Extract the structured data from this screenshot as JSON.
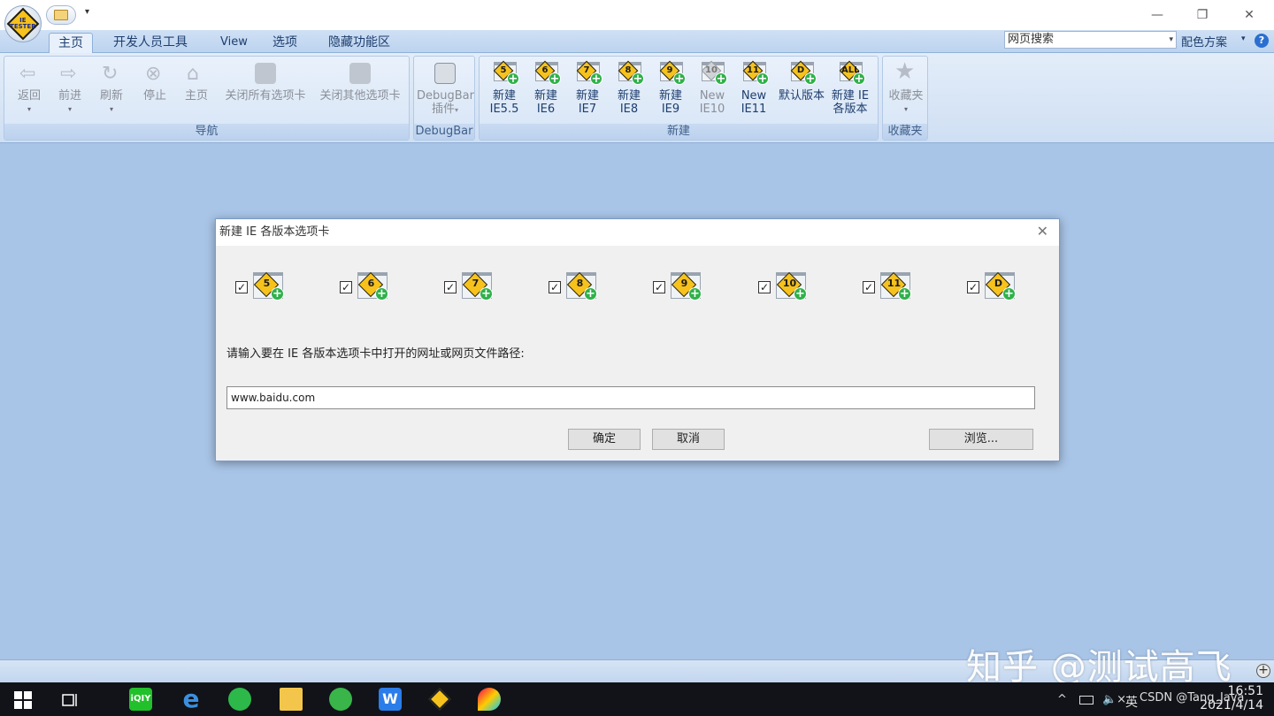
{
  "titlebar": {
    "logo_text": "IE TESTER",
    "qat_more": "▾",
    "minimize": "—",
    "restore": "❐",
    "close": "✕"
  },
  "tabs": [
    "主页",
    "开发人员工具",
    "View",
    "选项",
    "隐藏功能区"
  ],
  "search": {
    "value": "网页搜索",
    "drop": "▾"
  },
  "scheme": {
    "label": "配色方案",
    "drop": "▾",
    "help": "?"
  },
  "ribbon": {
    "nav_group": "导航",
    "nav_buttons": [
      "返回",
      "前进",
      "刷新",
      "停止",
      "主页",
      "关闭所有选项卡",
      "关闭其他选项卡"
    ],
    "debugbar_group": "DebugBar",
    "debugbar_button": [
      "DebugBar",
      "插件"
    ],
    "new_group": "新建",
    "new_buttons": [
      {
        "line1": "新建",
        "line2": "IE5.5",
        "badge": "5",
        "enabled": true
      },
      {
        "line1": "新建",
        "line2": "IE6",
        "badge": "6",
        "enabled": true
      },
      {
        "line1": "新建",
        "line2": "IE7",
        "badge": "7",
        "enabled": true
      },
      {
        "line1": "新建",
        "line2": "IE8",
        "badge": "8",
        "enabled": true
      },
      {
        "line1": "新建",
        "line2": "IE9",
        "badge": "9",
        "enabled": true
      },
      {
        "line1": "New",
        "line2": "IE10",
        "badge": "10",
        "enabled": false
      },
      {
        "line1": "New",
        "line2": "IE11",
        "badge": "11",
        "enabled": true
      },
      {
        "line1": "默认版本",
        "line2": "",
        "badge": "D",
        "enabled": true
      },
      {
        "line1": "新建 IE",
        "line2": "各版本",
        "badge": "ALL",
        "enabled": true
      }
    ],
    "fav_group": "收藏夹",
    "fav_button": "收藏夹"
  },
  "dialog": {
    "title": "新建 IE 各版本选项卡",
    "close": "✕",
    "versions": [
      "5",
      "6",
      "7",
      "8",
      "9",
      "10",
      "11",
      "D"
    ],
    "checked": "✓",
    "prompt": "请输入要在 IE 各版本选项卡中打开的网址或网页文件路径:",
    "url_value": "www.baidu.com",
    "ok": "确定",
    "cancel": "取消",
    "browse": "浏览..."
  },
  "statusbar": {
    "plus": "+"
  },
  "watermark": "知乎 @测试高飞",
  "taskbar": {
    "tray_up": "^",
    "speaker": "🔈×",
    "ime": "英",
    "csdn": "CSDN @Tang_Java",
    "time": "16:51",
    "date": "2021/4/14"
  }
}
